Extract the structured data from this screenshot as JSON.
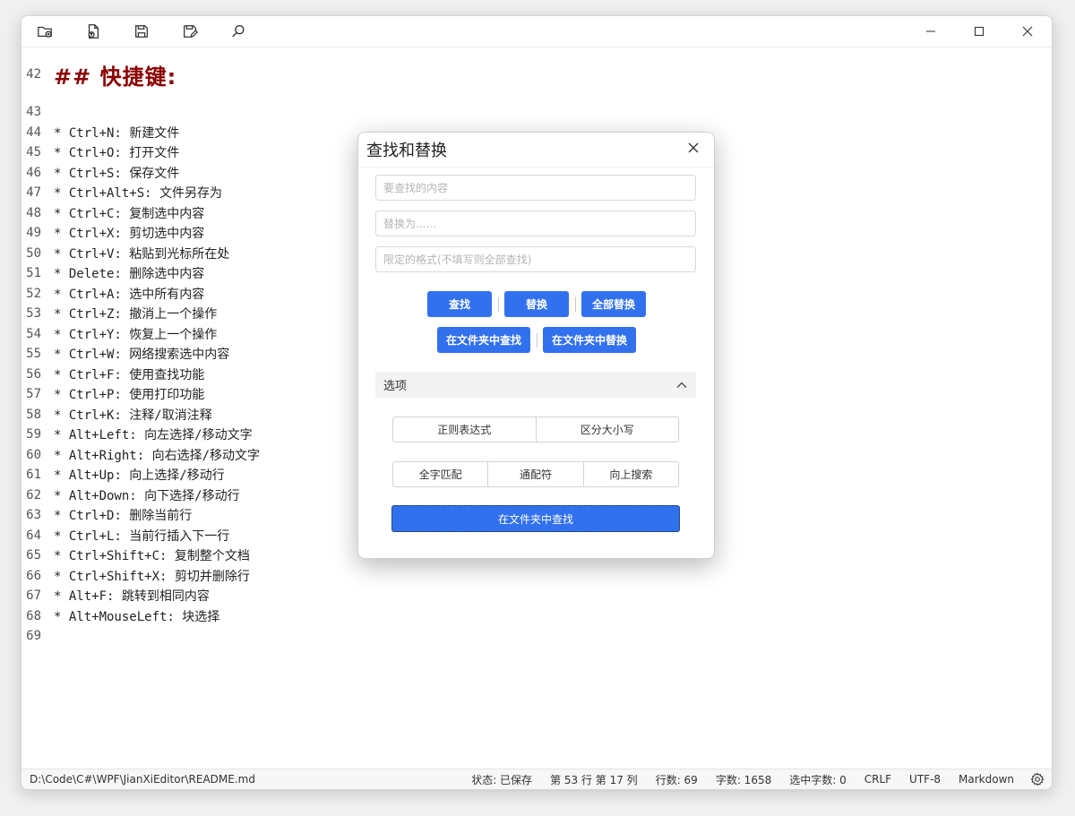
{
  "toolbar": {
    "icons": [
      "new-folder-icon",
      "open-file-icon",
      "save-icon",
      "save-as-icon",
      "search-icon"
    ]
  },
  "editor": {
    "lines": [
      {
        "num": "42",
        "text": "## 快捷键:",
        "heading": true
      },
      {
        "num": "43",
        "text": ""
      },
      {
        "num": "44",
        "text": "* Ctrl+N: 新建文件"
      },
      {
        "num": "45",
        "text": "* Ctrl+O: 打开文件"
      },
      {
        "num": "46",
        "text": "* Ctrl+S: 保存文件"
      },
      {
        "num": "47",
        "text": "* Ctrl+Alt+S: 文件另存为"
      },
      {
        "num": "48",
        "text": "* Ctrl+C: 复制选中内容"
      },
      {
        "num": "49",
        "text": "* Ctrl+X: 剪切选中内容"
      },
      {
        "num": "50",
        "text": "* Ctrl+V: 粘贴到光标所在处"
      },
      {
        "num": "51",
        "text": "* Delete: 删除选中内容"
      },
      {
        "num": "52",
        "text": "* Ctrl+A: 选中所有内容"
      },
      {
        "num": "53",
        "text": "* Ctrl+Z: 撤消上一个操作"
      },
      {
        "num": "54",
        "text": "* Ctrl+Y: 恢复上一个操作"
      },
      {
        "num": "55",
        "text": "* Ctrl+W: 网络搜索选中内容"
      },
      {
        "num": "56",
        "text": "* Ctrl+F: 使用查找功能"
      },
      {
        "num": "57",
        "text": "* Ctrl+P: 使用打印功能"
      },
      {
        "num": "58",
        "text": "* Ctrl+K: 注释/取消注释"
      },
      {
        "num": "59",
        "text": "* Alt+Left: 向左选择/移动文字"
      },
      {
        "num": "60",
        "text": "* Alt+Right: 向右选择/移动文字"
      },
      {
        "num": "61",
        "text": "* Alt+Up: 向上选择/移动行"
      },
      {
        "num": "62",
        "text": "* Alt+Down: 向下选择/移动行"
      },
      {
        "num": "63",
        "text": "* Ctrl+D: 删除当前行"
      },
      {
        "num": "64",
        "text": "* Ctrl+L: 当前行插入下一行"
      },
      {
        "num": "65",
        "text": "* Ctrl+Shift+C: 复制整个文档"
      },
      {
        "num": "66",
        "text": "* Ctrl+Shift+X: 剪切并删除行"
      },
      {
        "num": "67",
        "text": "* Alt+F: 跳转到相同内容"
      },
      {
        "num": "68",
        "text": "* Alt+MouseLeft: 块选择"
      },
      {
        "num": "69",
        "text": ""
      }
    ]
  },
  "dialog": {
    "title": "查找和替换",
    "find_placeholder": "要查找的内容",
    "replace_placeholder": "替换为......",
    "filter_placeholder": "限定的格式(不填写则全部查找)",
    "find_label": "查找",
    "replace_label": "替换",
    "replace_all_label": "全部替换",
    "find_in_folder_label": "在文件夹中查找",
    "replace_in_folder_label": "在文件夹中替换",
    "options_label": "选项",
    "regex_label": "正则表达式",
    "case_label": "区分大小写",
    "whole_word_label": "全字匹配",
    "wildcard_label": "通配符",
    "search_up_label": "向上搜索",
    "bottom_find_label": "在文件夹中查找"
  },
  "status": {
    "path": "D:\\Code\\C#\\WPF\\JianXiEditor\\README.md",
    "state": "状态: 已保存",
    "position": "第 53 行 第 17 列",
    "lines": "行数: 69",
    "chars": "字数: 1658",
    "selected": "选中字数: 0",
    "eol": "CRLF",
    "encoding": "UTF-8",
    "language": "Markdown"
  },
  "colors": {
    "accent": "#3271ee",
    "heading": "#8b0000"
  }
}
